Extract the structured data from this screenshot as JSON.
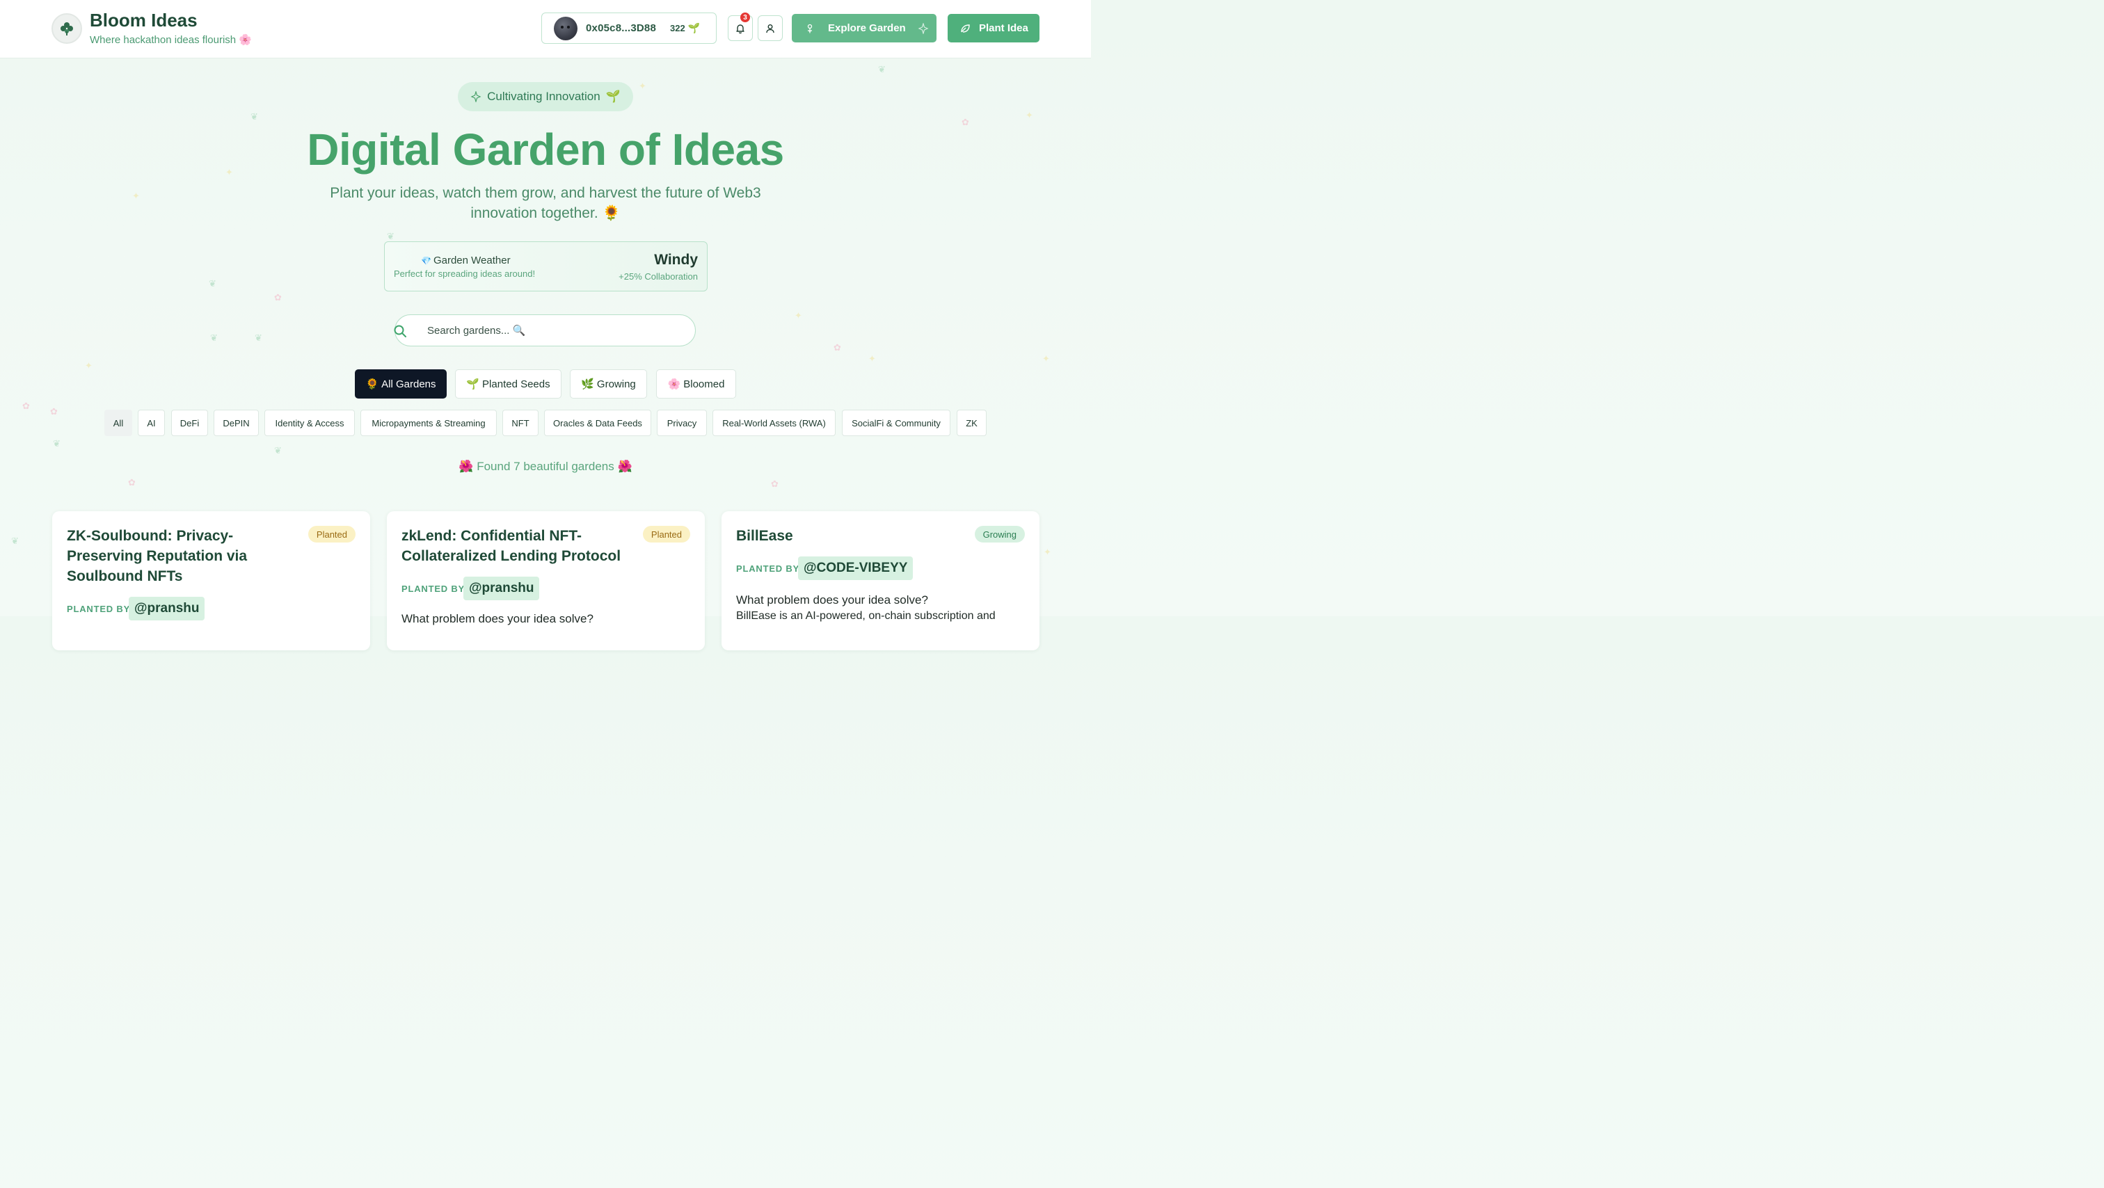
{
  "header": {
    "brand_title": "Bloom Ideas",
    "brand_subtitle": "Where hackathon ideas flourish 🌸",
    "wallet_address": "0x05c8...3D88",
    "wallet_points": "322",
    "wallet_icon": "🌱",
    "notification_count": "3",
    "explore_label": "Explore Garden",
    "plant_label": "Plant Idea"
  },
  "hero": {
    "pill_label": "Cultivating Innovation",
    "pill_icon": "🌱",
    "title": "Digital Garden of Ideas",
    "subtitle": "Plant your ideas, watch them grow, and harvest the future of Web3 innovation together. 🌻"
  },
  "weather": {
    "title": "Garden Weather",
    "icon": "💎",
    "description": "Perfect for spreading ideas around!",
    "condition": "Windy",
    "bonus": "+25% Collaboration"
  },
  "search": {
    "placeholder": "Search gardens... 🔍"
  },
  "stage_tabs": [
    {
      "icon": "🌻",
      "label": "All Gardens",
      "active": true
    },
    {
      "icon": "🌱",
      "label": "Planted Seeds",
      "active": false
    },
    {
      "icon": "🌿",
      "label": "Growing",
      "active": false
    },
    {
      "icon": "🌸",
      "label": "Bloomed",
      "active": false
    }
  ],
  "categories": [
    "All",
    "AI",
    "DeFi",
    "DePIN",
    "Identity & Access",
    "Micropayments & Streaming",
    "NFT",
    "Oracles & Data Feeds",
    "Privacy",
    "Real-World Assets (RWA)",
    "SocialFi & Community",
    "ZK"
  ],
  "results": {
    "text": "Found 7 beautiful gardens",
    "icon": "🌺"
  },
  "cards": [
    {
      "title": "ZK-Soulbound: Privacy-Preserving Reputation via Soulbound NFTs",
      "status": "Planted",
      "planted_by_label": "PLANTED BY",
      "author": "@pranshu"
    },
    {
      "title": "zkLend: Confidential NFT-Collateralized Lending Protocol",
      "status": "Planted",
      "planted_by_label": "PLANTED BY",
      "author": "@pranshu",
      "question": "What problem does your idea solve?"
    },
    {
      "title": "BillEase",
      "status": "Growing",
      "planted_by_label": "PLANTED BY",
      "author": "@CODE-VIBEYY",
      "question": "What problem does your idea solve?",
      "excerpt": "BillEase is an AI-powered, on-chain subscription and"
    }
  ],
  "colors": {
    "brand_green": "#4fb07c",
    "title_green": "#46a36a",
    "dark_tab": "#0e1726",
    "badge_planted": "#fbf1c4",
    "badge_growing": "#d7f1e1"
  }
}
